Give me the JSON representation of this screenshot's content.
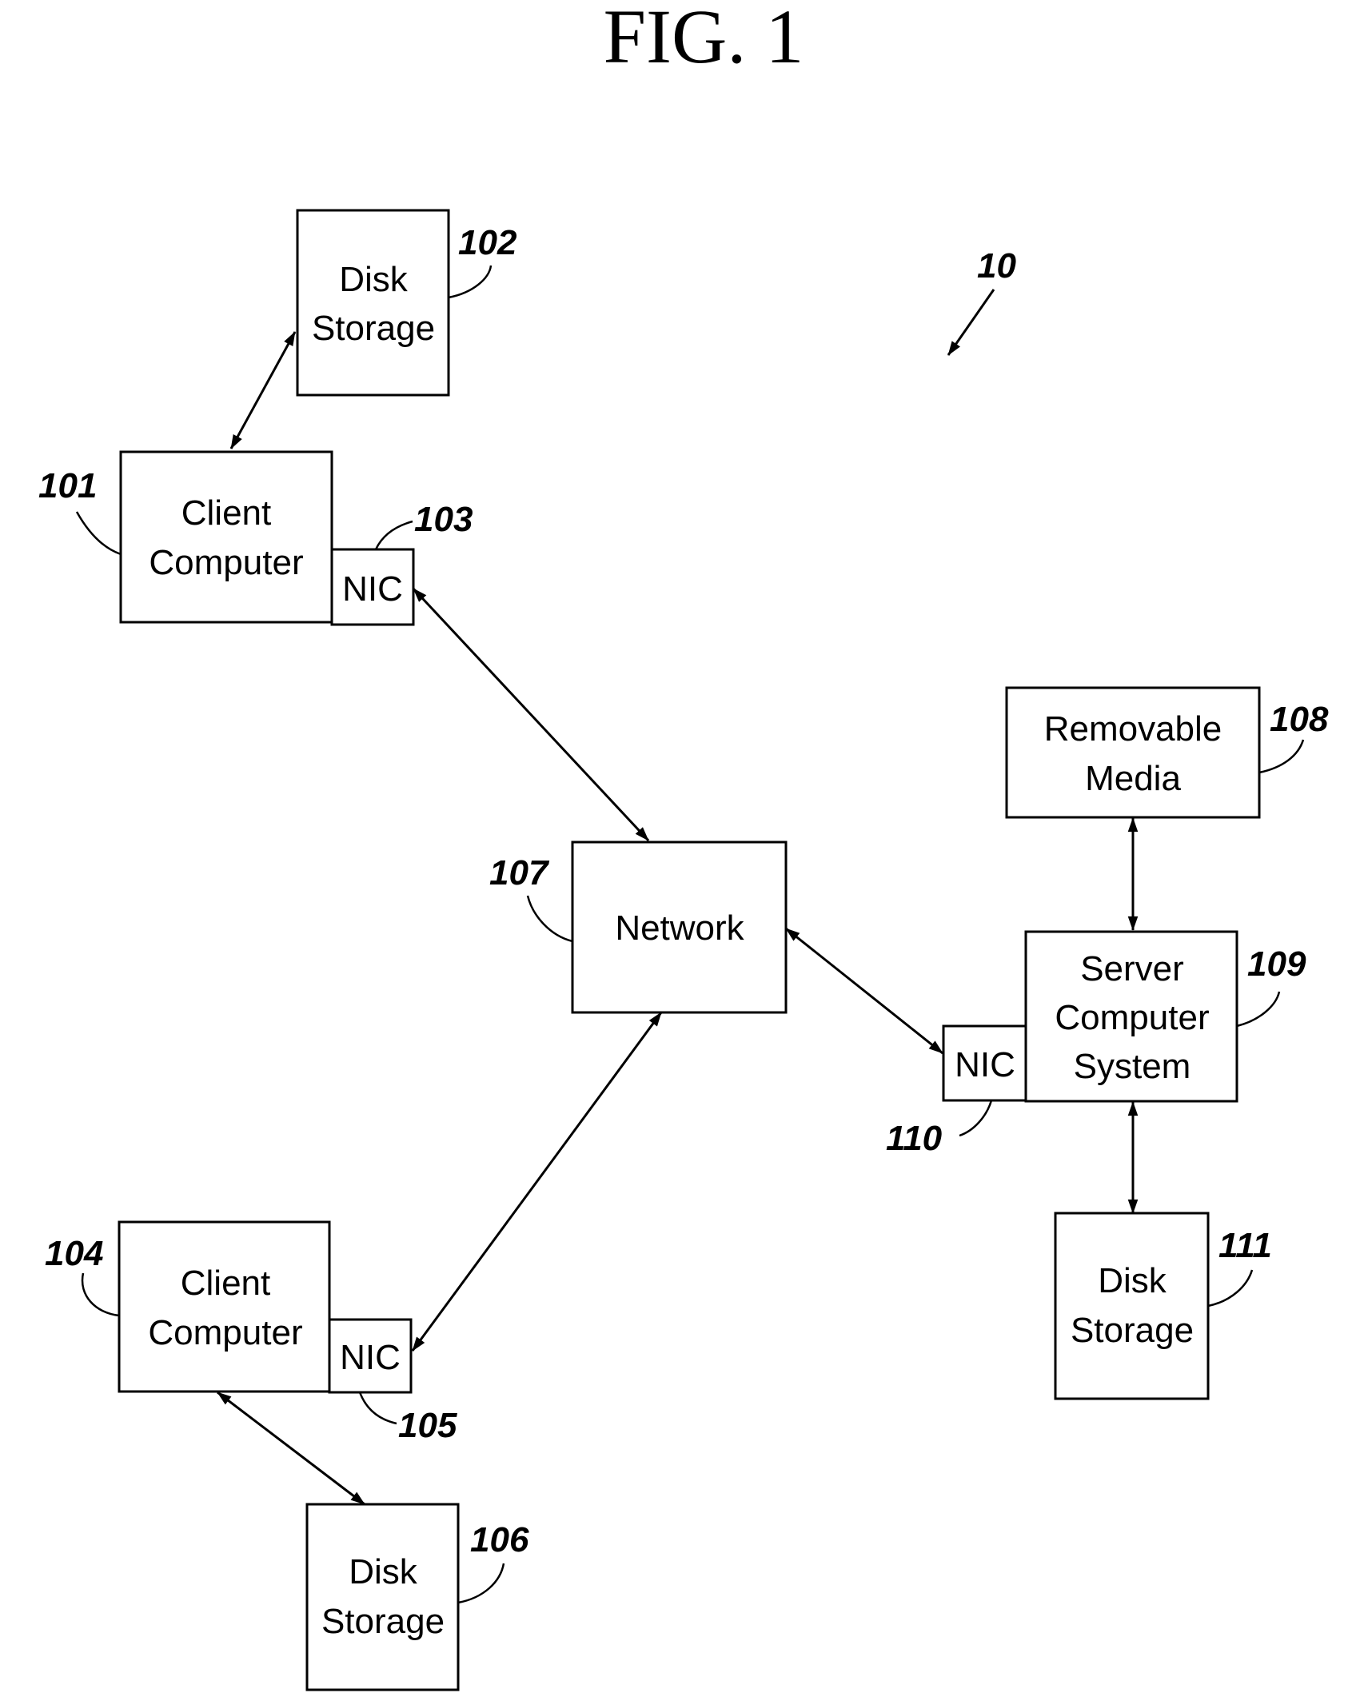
{
  "title": "FIG. 1",
  "system_ref": "10",
  "nodes": {
    "disk_102": {
      "lines": [
        "Disk",
        "Storage"
      ],
      "ref": "102"
    },
    "client_101": {
      "lines": [
        "Client",
        "Computer"
      ],
      "ref": "101"
    },
    "nic_103": {
      "lines": [
        "NIC"
      ],
      "ref": "103"
    },
    "network_107": {
      "lines": [
        "Network"
      ],
      "ref": "107"
    },
    "removable_108": {
      "lines": [
        "Removable",
        "Media"
      ],
      "ref": "108"
    },
    "server_109": {
      "lines": [
        "Server",
        "Computer",
        "System"
      ],
      "ref": "109"
    },
    "nic_110": {
      "lines": [
        "NIC"
      ],
      "ref": "110"
    },
    "disk_111": {
      "lines": [
        "Disk",
        "Storage"
      ],
      "ref": "111"
    },
    "client_104": {
      "lines": [
        "Client",
        "Computer"
      ],
      "ref": "104"
    },
    "nic_105": {
      "lines": [
        "NIC"
      ],
      "ref": "105"
    },
    "disk_106": {
      "lines": [
        "Disk",
        "Storage"
      ],
      "ref": "106"
    }
  },
  "connections": [
    {
      "from": "client_101",
      "to": "disk_102",
      "type": "bidirectional"
    },
    {
      "from": "nic_103",
      "to": "network_107",
      "type": "bidirectional"
    },
    {
      "from": "network_107",
      "to": "nic_110",
      "type": "bidirectional"
    },
    {
      "from": "network_107",
      "to": "nic_105",
      "type": "bidirectional"
    },
    {
      "from": "client_104",
      "to": "disk_106",
      "type": "bidirectional"
    },
    {
      "from": "removable_108",
      "to": "server_109",
      "type": "bidirectional"
    },
    {
      "from": "server_109",
      "to": "disk_111",
      "type": "bidirectional"
    }
  ]
}
